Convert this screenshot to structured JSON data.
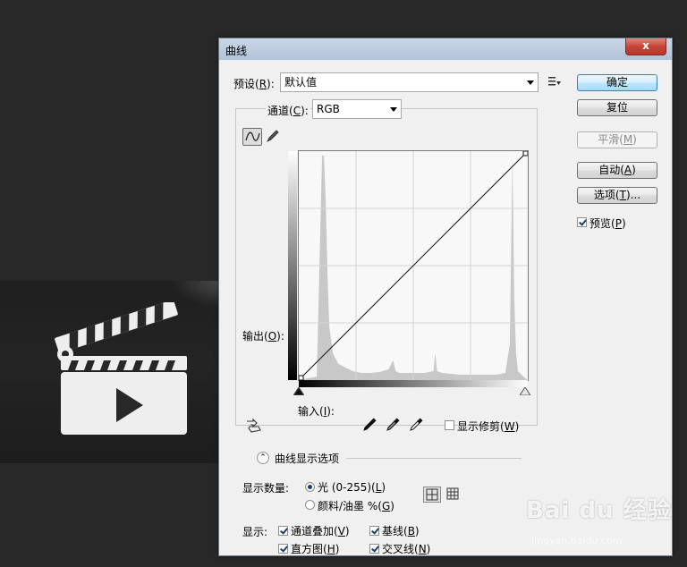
{
  "dialog": {
    "title": "曲线",
    "close_glyph": "x"
  },
  "preset": {
    "label": "预设(",
    "key": "R",
    "label_end": "):",
    "value": "默认值"
  },
  "channel": {
    "label": "通道(",
    "key": "C",
    "label_end": "):",
    "value": "RGB"
  },
  "graph": {
    "output_label": "输出(",
    "output_key": "O",
    "output_end": "):",
    "input_label": "输入(",
    "input_key": "I",
    "input_end": "):"
  },
  "chart_data": {
    "type": "area",
    "title": "",
    "xlabel": "输入(I):",
    "ylabel": "输出(O):",
    "xlim": [
      0,
      255
    ],
    "ylim": [
      0,
      255
    ],
    "grid": true,
    "grid_divisions": 4,
    "curve": {
      "x": [
        0,
        255
      ],
      "y": [
        0,
        255
      ]
    },
    "histogram": {
      "x": [
        0,
        10,
        20,
        26,
        28,
        30,
        32,
        34,
        38,
        44,
        52,
        60,
        70,
        80,
        90,
        100,
        105,
        108,
        112,
        120,
        140,
        150,
        152,
        154,
        160,
        180,
        200,
        220,
        230,
        235,
        238,
        240,
        242,
        244,
        250,
        255
      ],
      "y": [
        0,
        2,
        4,
        250,
        250,
        200,
        120,
        60,
        30,
        18,
        14,
        10,
        8,
        8,
        9,
        12,
        22,
        10,
        8,
        8,
        8,
        10,
        30,
        10,
        8,
        6,
        6,
        6,
        8,
        40,
        250,
        90,
        30,
        10,
        4,
        0
      ]
    }
  },
  "buttons": {
    "ok": "确定",
    "reset": "复位",
    "smooth": "平滑(",
    "smooth_key": "M",
    "smooth_end": ")",
    "auto": "自动(",
    "auto_key": "A",
    "auto_end": ")",
    "options": "选项(",
    "options_key": "T",
    "options_end": ")..."
  },
  "preview": {
    "label": "预览(",
    "key": "P",
    "label_end": ")",
    "checked": true
  },
  "show_clipping": {
    "label": "显示修剪(",
    "key": "W",
    "label_end": ")",
    "checked": false
  },
  "display_options": {
    "header": "曲线显示选项",
    "amount_label": "显示数量:",
    "light_label": "光 (0-255)(",
    "light_key": "L",
    "light_end": ")",
    "pigment_label": "颜料/油墨 %(",
    "pigment_key": "G",
    "pigment_end": ")",
    "show_label": "显示:",
    "channel_overlay_label": "通道叠加(",
    "channel_overlay_key": "V",
    "channel_overlay_end": ")",
    "baseline_label": "基线(",
    "baseline_key": "B",
    "baseline_end": ")",
    "histogram_label": "直方图(",
    "histogram_key": "H",
    "histogram_end": ")",
    "intersection_label": "交叉线(",
    "intersection_key": "N",
    "intersection_end": ")"
  },
  "watermark": {
    "text": "Bai du 经验",
    "url": "jingyan.baidu.com"
  },
  "colors": {
    "desktop": "#282828",
    "dialog_bg": "#f0f0f0",
    "titlebar": "#b8c9de",
    "close_button": "#c5443a",
    "histogram": "#c8c8c8"
  }
}
